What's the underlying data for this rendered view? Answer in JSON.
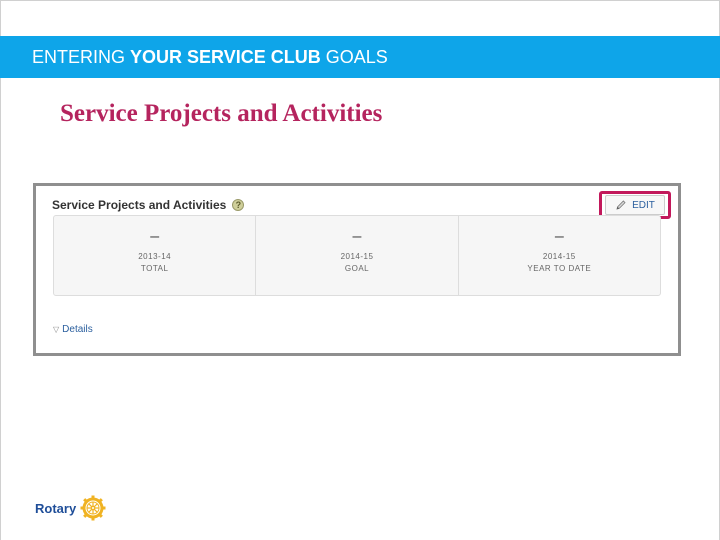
{
  "header": {
    "prefix": "ENTERING ",
    "emphasis": "YOUR SERVICE CLUB",
    "suffix": " GOALS",
    "color": "#0ea5e9"
  },
  "slide_title": "Service Projects and Activities",
  "panel": {
    "title": "Service Projects and Activities",
    "help_icon": "question-mark-icon",
    "edit_label": "EDIT",
    "highlight_color": "#c2185b",
    "stats": [
      {
        "value": "–",
        "period": "2013-14",
        "label": "TOTAL"
      },
      {
        "value": "–",
        "period": "2014-15",
        "label": "GOAL"
      },
      {
        "value": "–",
        "period": "2014-15",
        "label": "YEAR TO DATE"
      }
    ],
    "details_label": "Details"
  },
  "logo": {
    "wordmark": "Rotary",
    "icon": "rotary-wheel-icon"
  }
}
